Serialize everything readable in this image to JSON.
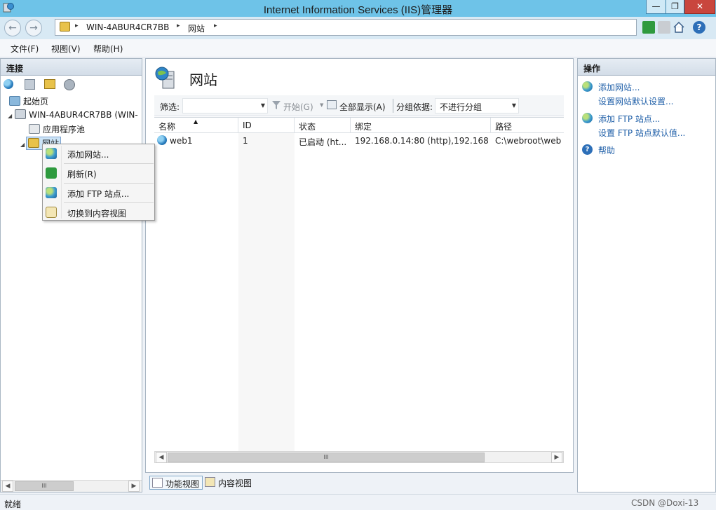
{
  "window": {
    "title": "Internet Information Services (IIS)管理器",
    "controls": {
      "minimize": "—",
      "maximize": "❐",
      "close": "✕"
    }
  },
  "address": {
    "segments": [
      "WIN-4ABUR4CR7BB",
      "网站"
    ],
    "separator": "▸",
    "back_glyph": "←",
    "forward_glyph": "→"
  },
  "menu": {
    "items": [
      "文件(F)",
      "视图(V)",
      "帮助(H)"
    ]
  },
  "connections": {
    "header": "连接",
    "tree": [
      {
        "label": "起始页",
        "icon": "start-page-icon"
      },
      {
        "label": "WIN-4ABUR4CR7BB (WIN-",
        "icon": "server-icon"
      },
      {
        "label": "应用程序池",
        "icon": "app-pool-icon"
      },
      {
        "label": "网站",
        "icon": "sites-folder-icon",
        "selected": true
      }
    ],
    "scroll_label": "III"
  },
  "context_menu": {
    "items": [
      {
        "label": "添加网站...",
        "icon": "add-website-icon"
      },
      {
        "label": "刷新(R)",
        "icon": "refresh-icon"
      },
      {
        "label": "添加 FTP 站点...",
        "icon": "add-ftp-icon"
      },
      {
        "label": "切换到内容视图",
        "icon": "content-view-icon"
      }
    ]
  },
  "main": {
    "title": "网站",
    "filter": {
      "label": "筛选:",
      "start_label": "开始(G)",
      "show_all_label": "全部显示(A)",
      "group_label": "分组依据:",
      "group_value": "不进行分组"
    },
    "columns": [
      "名称",
      "ID",
      "状态",
      "绑定",
      "路径"
    ],
    "sort_indicator": "▲",
    "rows": [
      {
        "name": "web1",
        "id": "1",
        "status": "已启动 (ht...",
        "binding": "192.168.0.14:80 (http),192.168....",
        "path": "C:\\webroot\\web"
      }
    ],
    "scroll_label": "III"
  },
  "view_tabs": {
    "features": "功能视图",
    "content": "内容视图"
  },
  "actions": {
    "header": "操作",
    "items": [
      {
        "label": "添加网站...",
        "icon": "add-website-icon"
      },
      {
        "label": "设置网站默认设置...",
        "icon": ""
      },
      {
        "label": "添加 FTP 站点...",
        "icon": "add-ftp-icon"
      },
      {
        "label": "设置 FTP 站点默认值...",
        "icon": ""
      },
      {
        "label": "帮助",
        "icon": "help-icon"
      }
    ]
  },
  "status": {
    "text": "就绪",
    "watermark": "CSDN @Doxi-13"
  },
  "colors": {
    "titlebar": "#6ec3e8",
    "link": "#1f5fa8",
    "selection": "#cce4f7"
  }
}
